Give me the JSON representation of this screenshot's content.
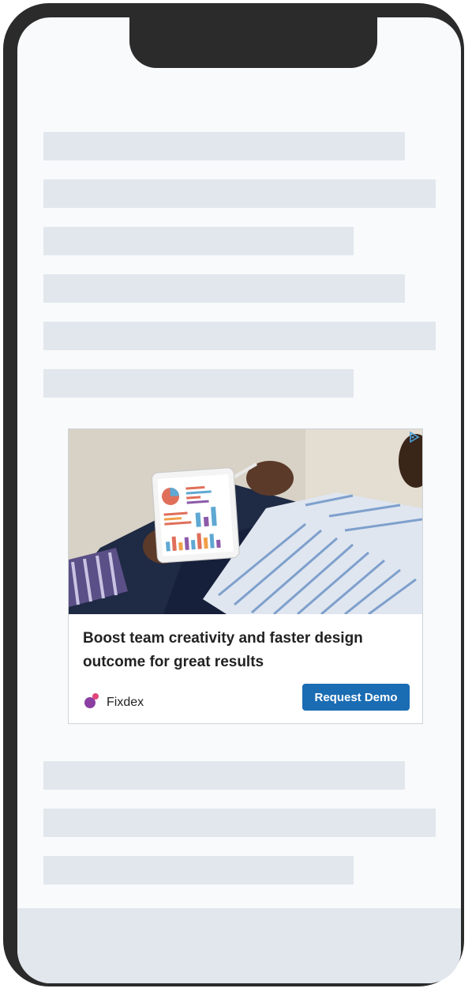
{
  "ad": {
    "headline": "Boost team creativity and faster design outcome for great results",
    "brand_name": "Fixdex",
    "cta_label": "Request Demo",
    "adchoices_icon": "adchoices-icon",
    "brand_logo_icon": "fixdex-logo-icon",
    "image": "business-person-holding-tablet-with-charts",
    "accent_color": "#1a6cb3"
  }
}
